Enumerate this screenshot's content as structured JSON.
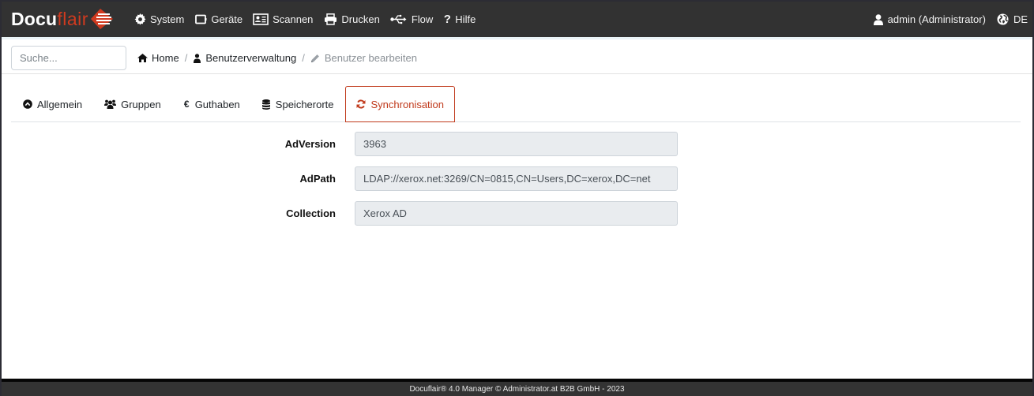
{
  "brand": {
    "part1": "Docu",
    "part2": "flair",
    "accent_color": "#d03a1f"
  },
  "navbar": {
    "items": [
      {
        "label": "System",
        "icon": "gear-icon"
      },
      {
        "label": "Geräte",
        "icon": "device-icon"
      },
      {
        "label": "Scannen",
        "icon": "id-card-icon"
      },
      {
        "label": "Drucken",
        "icon": "printer-icon"
      },
      {
        "label": "Flow",
        "icon": "usb-icon"
      },
      {
        "label": "Hilfe",
        "icon": "question-icon"
      }
    ],
    "user": {
      "label": "admin (Administrator)",
      "icon": "user-icon"
    },
    "language": {
      "label": "DE",
      "icon": "globe-icon"
    }
  },
  "search": {
    "placeholder": "Suche...",
    "value": ""
  },
  "breadcrumb": [
    {
      "label": "Home",
      "icon": "home-icon"
    },
    {
      "label": "Benutzerverwaltung",
      "icon": "user-icon"
    },
    {
      "label": "Benutzer bearbeiten",
      "icon": "pencil-icon",
      "active": true
    }
  ],
  "breadcrumb_separator": "/",
  "tabs": [
    {
      "label": "Allgemein",
      "icon": "chevron-circle-up-icon"
    },
    {
      "label": "Gruppen",
      "icon": "users-icon"
    },
    {
      "label": "Guthaben",
      "icon": "euro-icon"
    },
    {
      "label": "Speicherorte",
      "icon": "database-icon"
    },
    {
      "label": "Synchronisation",
      "icon": "refresh-icon",
      "active": true
    }
  ],
  "form": {
    "fields": [
      {
        "label": "AdVersion",
        "value": "3963"
      },
      {
        "label": "AdPath",
        "value": "LDAP://xerox.net:3269/CN=0815,CN=Users,DC=xerox,DC=net"
      },
      {
        "label": "Collection",
        "value": "Xerox AD"
      }
    ]
  },
  "footer": {
    "text": "Docuflair® 4.0 Manager © Administrator.at B2B GmbH - 2023"
  },
  "colors": {
    "navbar_bg": "#323232",
    "active_tab": "#c0391b",
    "input_readonly_bg": "#e9ecef"
  }
}
